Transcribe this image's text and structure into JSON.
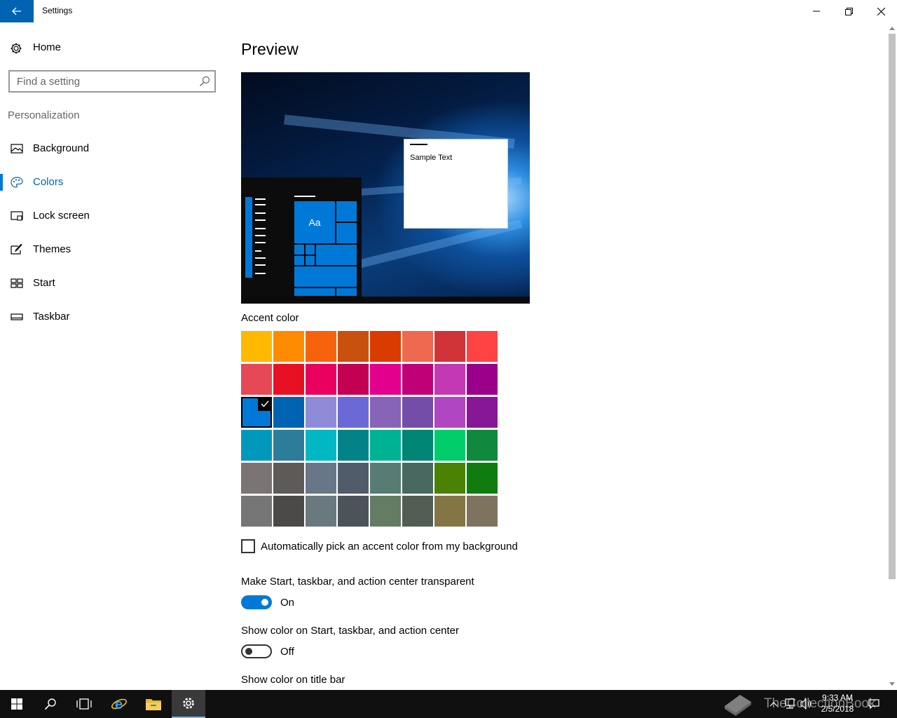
{
  "window": {
    "title": "Settings"
  },
  "sidebar": {
    "home_label": "Home",
    "search_placeholder": "Find a setting",
    "section_title": "Personalization",
    "items": [
      {
        "label": "Background",
        "icon": "picture-icon",
        "active": false
      },
      {
        "label": "Colors",
        "icon": "palette-icon",
        "active": true
      },
      {
        "label": "Lock screen",
        "icon": "lock-screen-icon",
        "active": false
      },
      {
        "label": "Themes",
        "icon": "themes-brush-icon",
        "active": false
      },
      {
        "label": "Start",
        "icon": "start-grid-icon",
        "active": false
      },
      {
        "label": "Taskbar",
        "icon": "taskbar-icon",
        "active": false
      }
    ]
  },
  "main": {
    "title": "Preview",
    "preview": {
      "sample_text": "Sample Text",
      "tile_label": "Aa"
    },
    "accent_title": "Accent color",
    "accent_colors": [
      [
        "#ffb900",
        "#ff8c00",
        "#f7630c",
        "#ca5010",
        "#da3b01",
        "#ef6950",
        "#d13438",
        "#ff4343"
      ],
      [
        "#e74856",
        "#e81123",
        "#ea005e",
        "#c30052",
        "#e3008c",
        "#bf0077",
        "#c239b3",
        "#9a0089"
      ],
      [
        "#0078d7",
        "#0063b1",
        "#8e8cd8",
        "#6b69d6",
        "#8764b8",
        "#744da9",
        "#b146c2",
        "#881798"
      ],
      [
        "#0099bc",
        "#2d7d9a",
        "#00b7c3",
        "#038387",
        "#00b294",
        "#018574",
        "#00cc6a",
        "#10893e"
      ],
      [
        "#7a7574",
        "#5d5a58",
        "#68768a",
        "#515c6b",
        "#567c73",
        "#486860",
        "#498205",
        "#107c10"
      ],
      [
        "#767676",
        "#4c4a48",
        "#69797e",
        "#4a5459",
        "#647c64",
        "#525e54",
        "#847545",
        "#7e735f"
      ]
    ],
    "selected_color": "#0078d7",
    "auto_pick_label": "Automatically pick an accent color from my background",
    "auto_pick_checked": false,
    "transparency": {
      "label": "Make Start, taskbar, and action center transparent",
      "state": "On"
    },
    "show_color_start": {
      "label": "Show color on Start, taskbar, and action center",
      "state": "Off"
    },
    "show_color_titlebar": {
      "label": "Show color on title bar"
    }
  },
  "taskbar": {
    "time": "9:33 AM",
    "date": "2/5/2018",
    "watermark": "TheCollectionBook",
    "pinned": [
      "start-icon",
      "search-icon",
      "task-view-icon",
      "internet-explorer-icon",
      "file-explorer-icon",
      "settings-gear-icon"
    ]
  }
}
